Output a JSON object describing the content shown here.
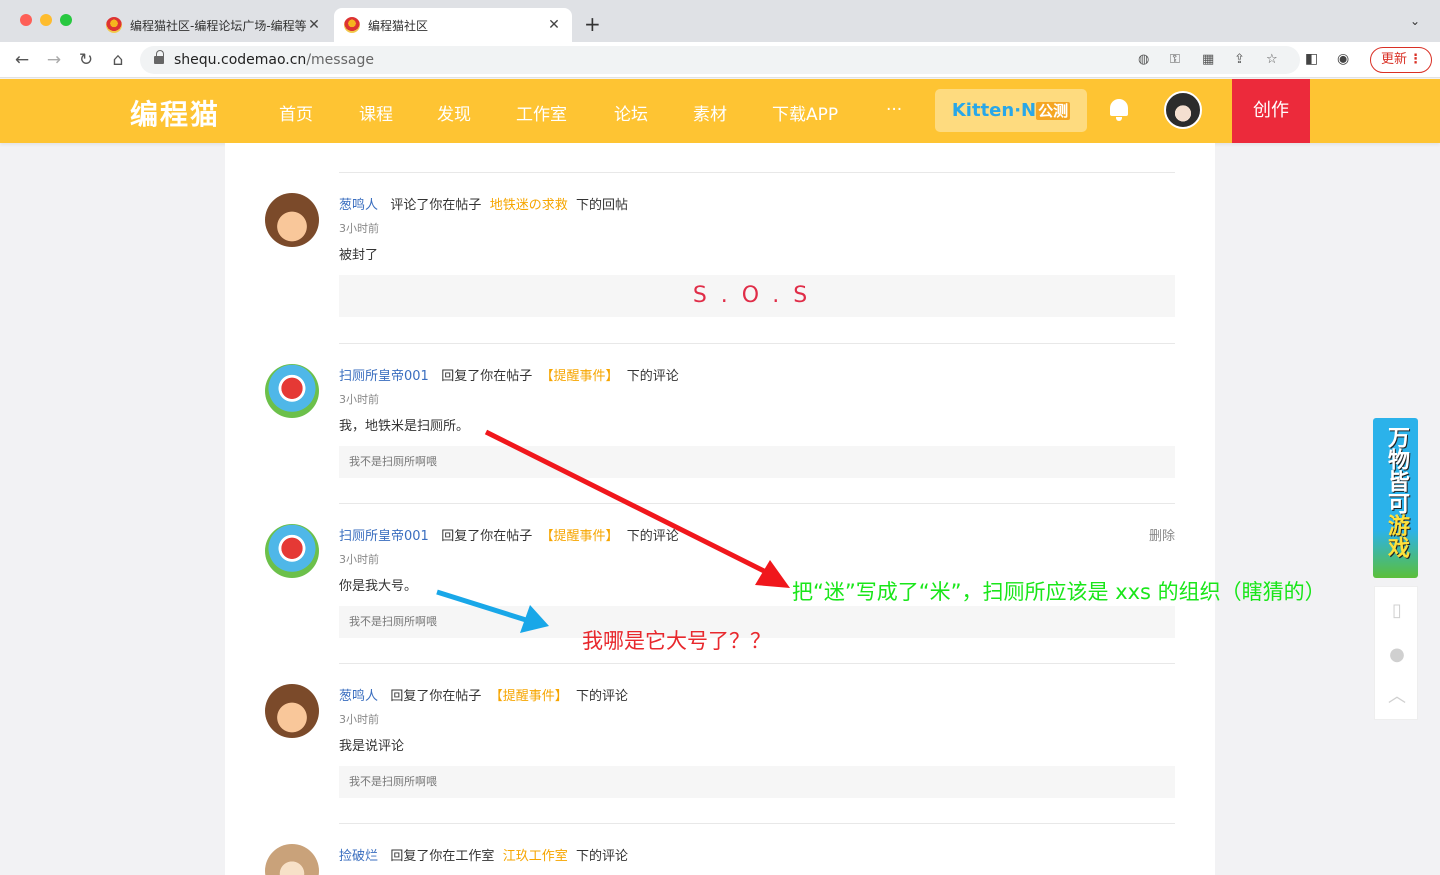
{
  "browser": {
    "tabs": [
      {
        "title": "编程猫社区-编程论坛广场-编程等",
        "active": false
      },
      {
        "title": "编程猫社区",
        "active": true
      }
    ],
    "new_tab": "+",
    "url_host": "shequ.codemao.cn",
    "url_path": "/message",
    "update_label": "更新"
  },
  "site": {
    "logo": "编程猫",
    "nav": [
      "首页",
      "课程",
      "发现",
      "工作室",
      "论坛",
      "素材",
      "下载APP",
      "···"
    ],
    "kitten_label": "Kitten·N",
    "kitten_badge": "公测",
    "create_label": "创作"
  },
  "messages": [
    {
      "user": "葱鸣人",
      "action": "评论了你在帖子",
      "post": "地铁迷の求救",
      "suffix": "下的回帖",
      "time": "3小时前",
      "body": "被封了",
      "quote": "S.O.S",
      "delete": ""
    },
    {
      "user": "扫厕所皇帝001",
      "action": "回复了你在帖子",
      "post": "【提醒事件】",
      "suffix": "下的评论",
      "time": "3小时前",
      "body": "我，地铁米是扫厕所。",
      "quote": "我不是扫厕所啊喂",
      "delete": ""
    },
    {
      "user": "扫厕所皇帝001",
      "action": "回复了你在帖子",
      "post": "【提醒事件】",
      "suffix": "下的评论",
      "time": "3小时前",
      "body": "你是我大号。",
      "quote": "我不是扫厕所啊喂",
      "delete": "删除"
    },
    {
      "user": "葱鸣人",
      "action": "回复了你在帖子",
      "post": "【提醒事件】",
      "suffix": "下的评论",
      "time": "3小时前",
      "body": "我是说评论",
      "quote": "我不是扫厕所啊喂",
      "delete": ""
    },
    {
      "user": "捡破烂",
      "action": "回复了你在工作室",
      "post": "江玖工作室",
      "suffix": "下的评论",
      "time": "",
      "body": "",
      "quote": "",
      "delete": ""
    }
  ],
  "annotations": {
    "green": "把“迷”写成了“米”，扫厕所应该是 xxs 的组织（瞎猜的）",
    "red": "我哪是它大号了？？"
  },
  "promo": {
    "text_a": "万物皆可",
    "text_b": "游戏"
  },
  "colors": {
    "header": "#fec433",
    "create": "#ec2a3b",
    "user_link": "#3a6ebf",
    "post_link": "#f6a500",
    "annot_green": "#19e619",
    "annot_red": "#e8282d",
    "arrow_blue": "#19a7e8"
  }
}
